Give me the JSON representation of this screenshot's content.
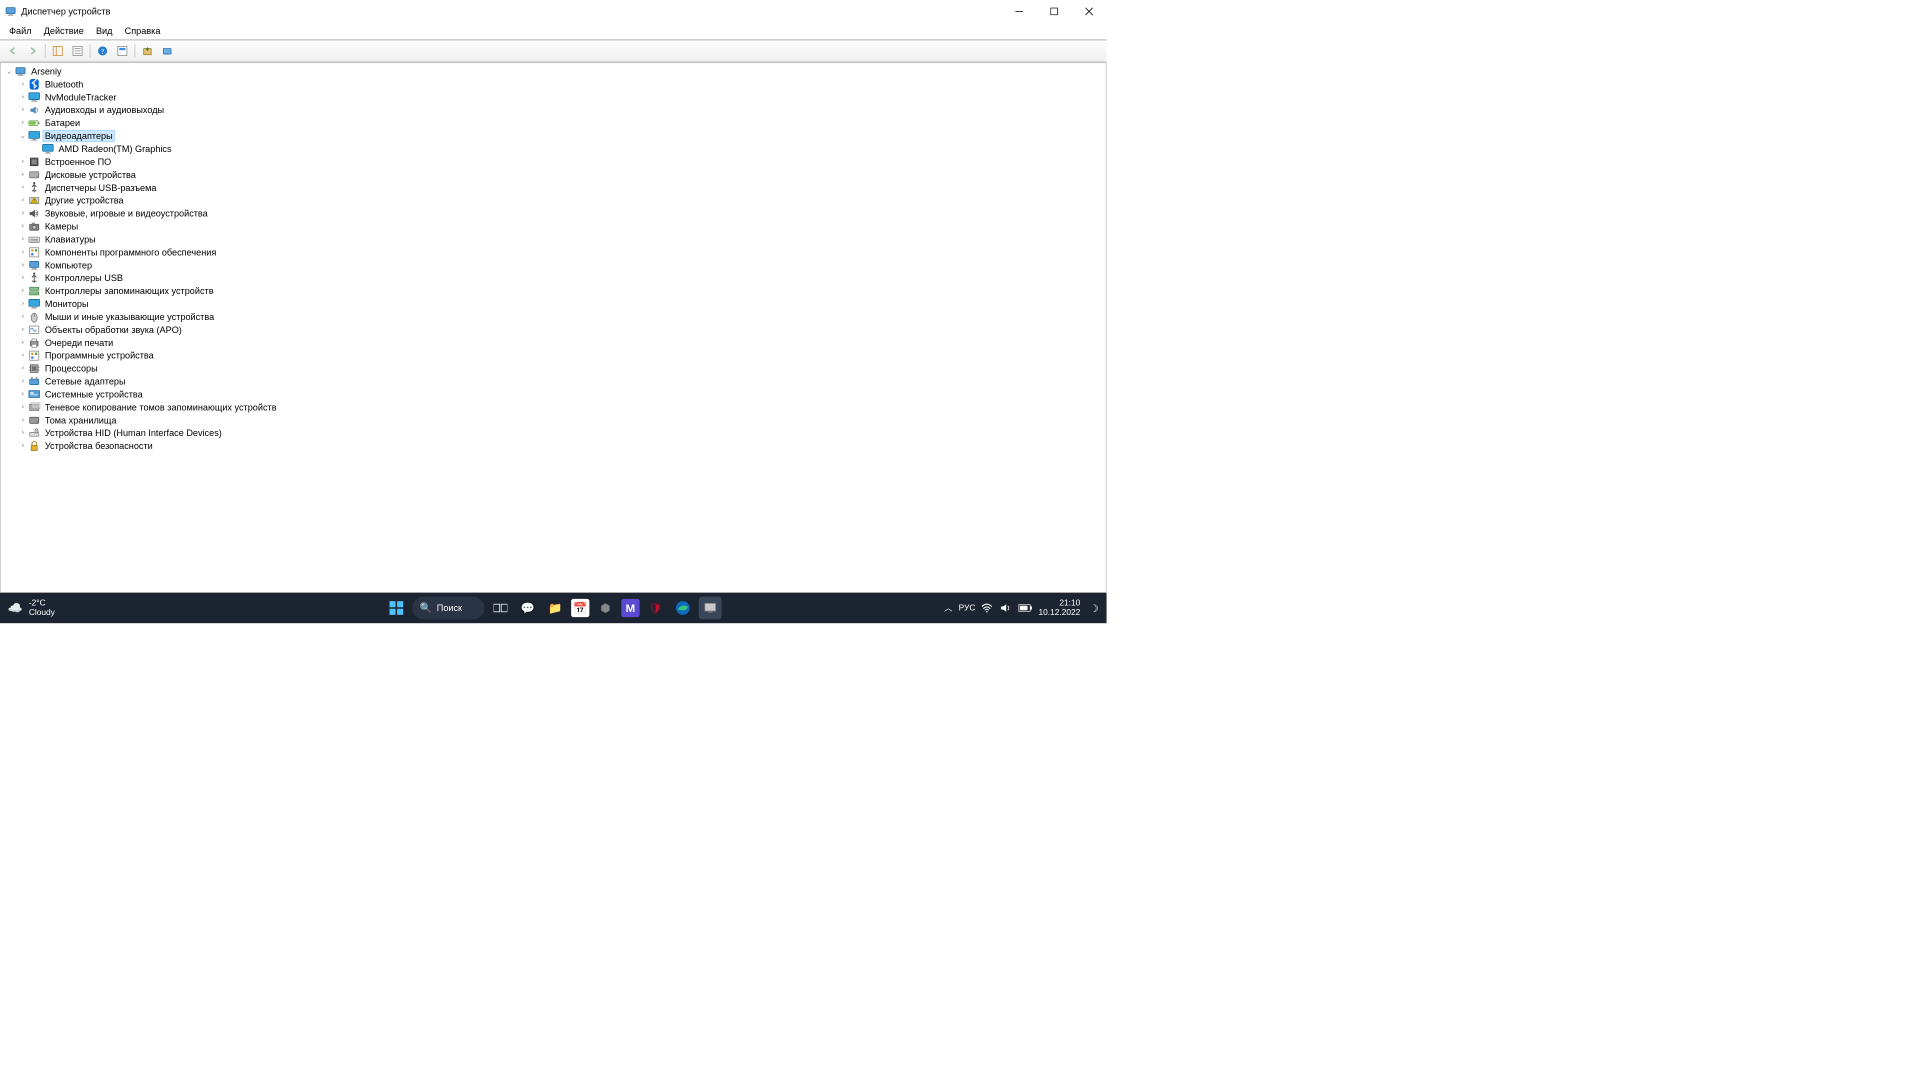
{
  "window": {
    "title": "Диспетчер устройств",
    "menus": [
      "Файл",
      "Действие",
      "Вид",
      "Справка"
    ]
  },
  "tree": {
    "root": {
      "label": "Arseniy",
      "expanded": true,
      "icon": "computer"
    },
    "nodes": [
      {
        "label": "Bluetooth",
        "icon": "bluetooth",
        "expanded": false
      },
      {
        "label": "NvModuleTracker",
        "icon": "monitor",
        "expanded": false
      },
      {
        "label": "Аудиовходы и аудиовыходы",
        "icon": "audio",
        "expanded": false
      },
      {
        "label": "Батареи",
        "icon": "battery",
        "expanded": false
      },
      {
        "label": "Видеоадаптеры",
        "icon": "display",
        "expanded": true,
        "selected": true,
        "children": [
          {
            "label": "AMD Radeon(TM) Graphics",
            "icon": "display"
          }
        ]
      },
      {
        "label": "Встроенное ПО",
        "icon": "chip",
        "expanded": false
      },
      {
        "label": "Дисковые устройства",
        "icon": "disk",
        "expanded": false
      },
      {
        "label": "Диспетчеры USB-разъема",
        "icon": "usb",
        "expanded": false
      },
      {
        "label": "Другие устройства",
        "icon": "warn",
        "expanded": false
      },
      {
        "label": "Звуковые, игровые и видеоустройства",
        "icon": "sound",
        "expanded": false
      },
      {
        "label": "Камеры",
        "icon": "camera",
        "expanded": false
      },
      {
        "label": "Клавиатуры",
        "icon": "keyboard",
        "expanded": false
      },
      {
        "label": "Компоненты программного обеспечения",
        "icon": "sw",
        "expanded": false
      },
      {
        "label": "Компьютер",
        "icon": "computer",
        "expanded": false
      },
      {
        "label": "Контроллеры USB",
        "icon": "usb",
        "expanded": false
      },
      {
        "label": "Контроллеры запоминающих устройств",
        "icon": "storage",
        "expanded": false
      },
      {
        "label": "Мониторы",
        "icon": "monitor",
        "expanded": false
      },
      {
        "label": "Мыши и иные указывающие устройства",
        "icon": "mouse",
        "expanded": false
      },
      {
        "label": "Объекты обработки звука (APO)",
        "icon": "apo",
        "expanded": false
      },
      {
        "label": "Очереди печати",
        "icon": "printer",
        "expanded": false
      },
      {
        "label": "Программные устройства",
        "icon": "sw",
        "expanded": false
      },
      {
        "label": "Процессоры",
        "icon": "cpu",
        "expanded": false
      },
      {
        "label": "Сетевые адаптеры",
        "icon": "network",
        "expanded": false
      },
      {
        "label": "Системные устройства",
        "icon": "system",
        "expanded": false
      },
      {
        "label": "Теневое копирование томов запоминающих устройств",
        "icon": "shadow",
        "expanded": false
      },
      {
        "label": "Тома хранилища",
        "icon": "volume",
        "expanded": false
      },
      {
        "label": "Устройства HID (Human Interface Devices)",
        "icon": "hid",
        "expanded": false
      },
      {
        "label": "Устройства безопасности",
        "icon": "security",
        "expanded": false
      }
    ]
  },
  "taskbar": {
    "weather": {
      "temp": "-2°C",
      "desc": "Cloudy"
    },
    "search": "Поиск",
    "lang": "РУС",
    "time": "21:10",
    "date": "10.12.2022"
  }
}
